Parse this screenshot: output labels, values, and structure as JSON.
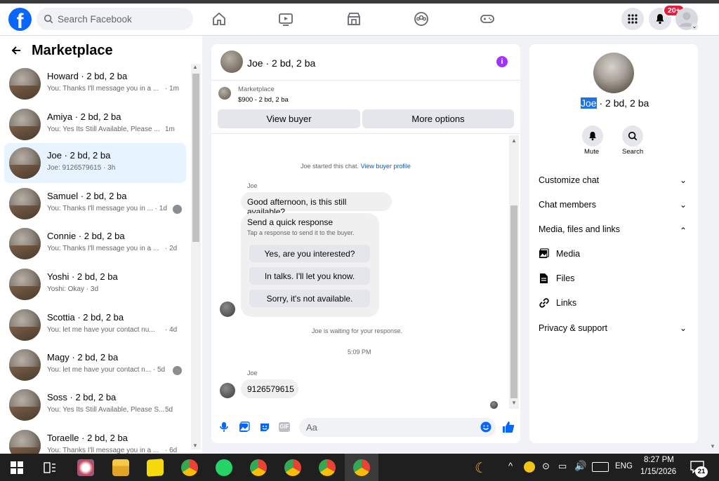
{
  "header": {
    "search_placeholder": "Search Facebook",
    "notification_count": "20+"
  },
  "left": {
    "title": "Marketplace",
    "conversations": [
      {
        "name": "Howard · 2 bd, 2 ba",
        "preview": "You: Thanks I'll message you in a ...",
        "time": "· 1m"
      },
      {
        "name": "Amiya · 2 bd, 2 ba",
        "preview": "You: Yes Its Still Available, Please ...",
        "time": "1m"
      },
      {
        "name": "Joe · 2 bd, 2 ba",
        "preview": "Joe: 9126579615 · 3h",
        "time": ""
      },
      {
        "name": "Samuel · 2 bd, 2 ba",
        "preview": "You: Thanks I'll message you in ... · 1d",
        "time": ""
      },
      {
        "name": "Connie · 2 bd, 2 ba",
        "preview": "You: Thanks I'll message you in a ...",
        "time": "· 2d"
      },
      {
        "name": "Yoshi · 2 bd, 2 ba",
        "preview": "Yoshi: Okay · 3d",
        "time": ""
      },
      {
        "name": "Scottia · 2 bd, 2 ba",
        "preview": "You: let me have your contact nu...",
        "time": "· 4d"
      },
      {
        "name": "Magy · 2 bd, 2 ba",
        "preview": "You: let me have your contact n... · 5d",
        "time": ""
      },
      {
        "name": "Soss · 2 bd, 2 ba",
        "preview": "You: Yes Its Still Available, Please S...",
        "time": "5d"
      },
      {
        "name": "Toraelle · 2 bd, 2 ba",
        "preview": "You: Thanks I'll message you in a ...",
        "time": "· 6d"
      }
    ]
  },
  "chat": {
    "title": "Joe · 2 bd, 2 ba",
    "listing_label": "Marketplace",
    "listing_detail": "$900 - 2 bd, 2 ba",
    "view_buyer": "View buyer",
    "more_options": "More options",
    "started_text": "Joe started this chat.",
    "view_profile_link": "View buyer profile",
    "sender": "Joe",
    "message1": "Good afternoon, is this still available?",
    "quick_title": "Send a quick response",
    "quick_sub": "Tap a response to send it to the buyer.",
    "quick_options": [
      "Yes, are you interested?",
      "In talks. I'll let you know.",
      "Sorry, it's not available."
    ],
    "waiting": "Joe is waiting for your response.",
    "timestamp": "5:09 PM",
    "sender2": "Joe",
    "message2": "9126579615",
    "input_placeholder": "Aa"
  },
  "details": {
    "name_highlight": "Joe",
    "name_rest": " · 2 bd, 2 ba",
    "mute": "Mute",
    "search": "Search",
    "sections": [
      "Customize chat",
      "Chat members",
      "Media, files and links"
    ],
    "media_items": [
      "Media",
      "Files",
      "Links"
    ],
    "privacy": "Privacy & support"
  },
  "taskbar": {
    "time": "8:27 PM",
    "date": "1/15/2026",
    "lang": "ENG",
    "notif": "21"
  },
  "colors": {
    "accent": "#0866ff",
    "purple": "#a033ff",
    "highlight": "#1a73e8"
  }
}
